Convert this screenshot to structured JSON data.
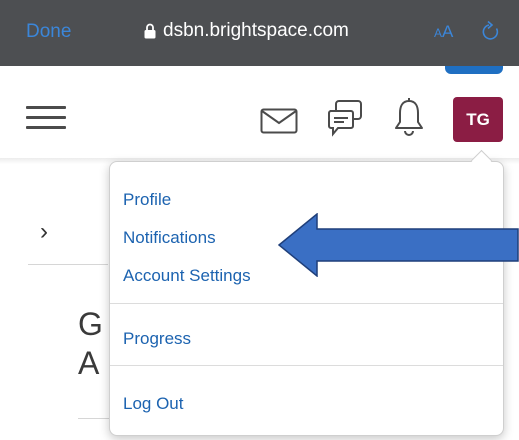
{
  "browser": {
    "done_label": "Done",
    "url": "dsbn.brightspace.com",
    "text_size_small": "A",
    "text_size_large": "A"
  },
  "header": {
    "avatar_initials": "TG",
    "avatar_color": "#8b1d44"
  },
  "page": {
    "heading_line1": "G",
    "heading_line2": "A"
  },
  "menu": {
    "items": [
      {
        "label": "Profile"
      },
      {
        "label": "Notifications"
      },
      {
        "label": "Account Settings"
      },
      {
        "label": "Progress"
      },
      {
        "label": "Log Out"
      }
    ]
  },
  "colors": {
    "link": "#1c63b0",
    "browser_accent": "#3b86d9",
    "annotation_arrow": "#3a6fc4"
  }
}
